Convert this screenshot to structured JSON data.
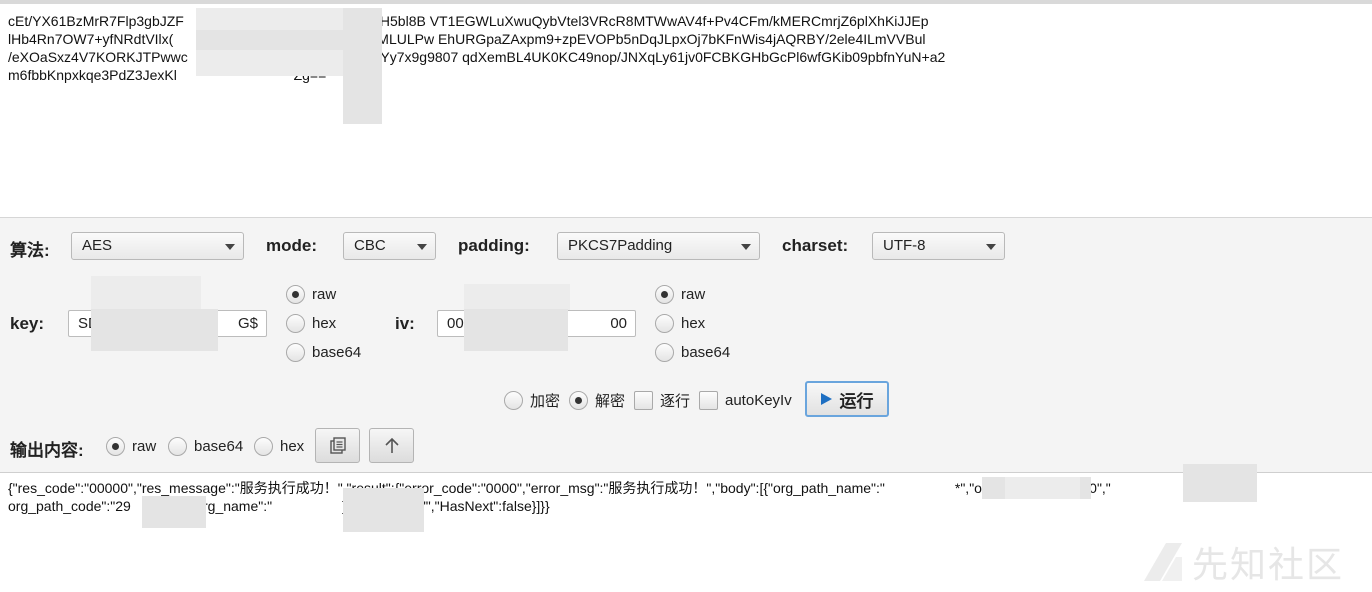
{
  "input": {
    "lines": [
      "cEt/YX61BzMrR7Flp3gbJZF                              nX5c3zd7jjJfH5bl8B VT1EGWLuXwuQybVtel3VRcR8MTWwAV4f+Pv4CFm/kMERCmrjZ6plXhKiJJEp",
      "lHb4Rn7OW7+yfNRdtVIlx(                               g1/U7+RWIOMLULPw EhURGpaZAxpm9+zpEVOPb5nDqJLpxOj7bKFnWis4jAQRBY/2ele4ILmVVBul",
      "/eXOaSxz4V7KORKJTPwwc                              wnTOIRysGYy7x9g9807 qdXemBL4UK0KC49nop/JNXqLy61jv0FCBKGHbGcPl6wfGKib09pbfnYuN+a2",
      "m6fbbKnpxkqe3PdZ3JexKl                              Zg=="
    ]
  },
  "controls": {
    "algorithm_label": "算法:",
    "algorithm_value": "AES",
    "mode_label": "mode:",
    "mode_value": "CBC",
    "padding_label": "padding:",
    "padding_value": "PKCS7Padding",
    "charset_label": "charset:",
    "charset_value": "UTF-8",
    "key_label": "key:",
    "key_start": "SD",
    "key_end": "G$",
    "iv_label": "iv:",
    "iv_start": "00",
    "iv_end": "00",
    "key_formats": [
      {
        "label": "raw",
        "selected": true
      },
      {
        "label": "hex",
        "selected": false
      },
      {
        "label": "base64",
        "selected": false
      }
    ],
    "iv_formats": [
      {
        "label": "raw",
        "selected": true
      },
      {
        "label": "hex",
        "selected": false
      },
      {
        "label": "base64",
        "selected": false
      }
    ],
    "encrypt_label": "加密",
    "decrypt_label": "解密",
    "decrypt_selected": true,
    "line_by_line_label": "逐行",
    "auto_key_iv_label": "autoKeyIv",
    "run_label": "运行",
    "output_label": "输出内容:",
    "output_formats": [
      {
        "label": "raw",
        "selected": true
      },
      {
        "label": "base64",
        "selected": false
      },
      {
        "label": "hex",
        "selected": false
      }
    ]
  },
  "output": {
    "lines": [
      "{\"res_code\":\"00000\",\"res_message\":\"服务执行成功！\",\"result\":{\"error_code\":\"0000\",\"error_msg\":\"服务执行成功！\",\"body\":[{\"org_path_name\":\"                  *\",\"org_id\":\"2              0\",\"",
      "org_path_code\":\"29           0\",\"org_name\":\"                  ]*\",\"area_id\":\"\",\"HasNext\":false}]}}"
    ]
  },
  "watermark": {
    "text": "先知社区"
  }
}
